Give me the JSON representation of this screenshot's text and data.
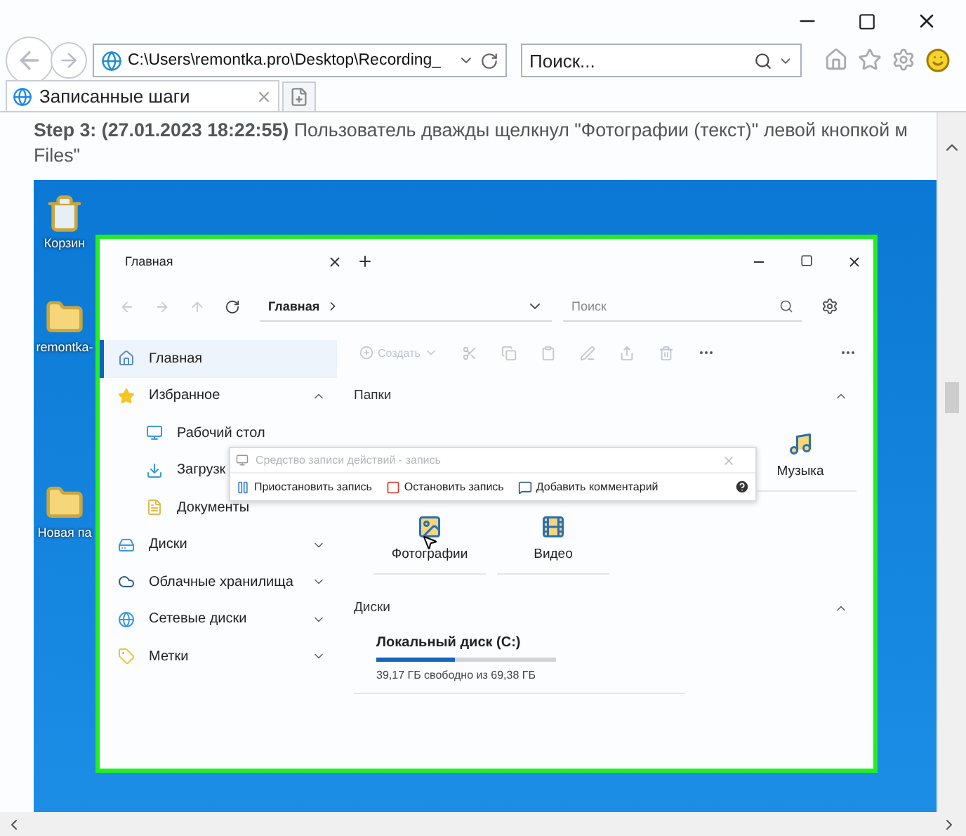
{
  "browser": {
    "address": "C:\\Users\\remontka.pro\\Desktop\\Recording_",
    "search_placeholder": "Поиск...",
    "tabs": [
      {
        "label": "Записанные шаги",
        "selected": true
      }
    ]
  },
  "step": {
    "lines": [
      "**Step 3: (27.01.2023 18:22:55)** Пользователь дважды щелкнул \"Фотографии (текст)\" левой кнопкой м",
      "Files\""
    ]
  },
  "desktop": {
    "icons": [
      {
        "label": "Корзин",
        "kind": "recycle"
      },
      {
        "label": "remontka-",
        "kind": "folder"
      },
      {
        "label": "Новая па",
        "kind": "folder"
      }
    ]
  },
  "explorer": {
    "tab": "Главная",
    "breadcrumb": "Главная",
    "search_placeholder": "Поиск",
    "sidebar": [
      {
        "label": "Главная",
        "kind": "home",
        "selected": true
      },
      {
        "label": "Избранное",
        "kind": "star",
        "selected": false,
        "expanded": true,
        "children": [
          {
            "label": "Рабочий стол",
            "kind": "desktop",
            "selected": false
          },
          {
            "label": "Загрузк",
            "kind": "download",
            "selected": false
          },
          {
            "label": "Документы",
            "kind": "document",
            "selected": false
          }
        ]
      },
      {
        "label": "Диски",
        "kind": "drive",
        "selected": false,
        "expanded": false
      },
      {
        "label": "Облачные хранилища",
        "kind": "cloud",
        "selected": false,
        "expanded": false
      },
      {
        "label": "Сетевые диски",
        "kind": "network",
        "selected": false,
        "expanded": false
      },
      {
        "label": "Метки",
        "kind": "tag",
        "selected": false,
        "expanded": false
      }
    ],
    "toolbar": {
      "new_label": "Создать"
    },
    "folders_section": {
      "title": "Папки",
      "expanded": true,
      "folders": [
        {
          "label": "Музыка",
          "kind": "music"
        },
        {
          "label": "Фотографии",
          "kind": "photo"
        },
        {
          "label": "Видео",
          "kind": "video"
        }
      ]
    },
    "drives_section": {
      "title": "Диски",
      "expanded": true,
      "drives": [
        {
          "name": "Локальный диск (C:)",
          "level": 0.44,
          "free": "39,17 ГБ свободно из 69,38 ГБ"
        }
      ]
    }
  },
  "recorder": {
    "title": "Средство записи действий - запись",
    "buttons": [
      {
        "label": "Приостановить запись",
        "kind": "pause"
      },
      {
        "label": "Остановить запись",
        "kind": "stop"
      },
      {
        "label": "Добавить комментарий",
        "kind": "comment"
      }
    ]
  }
}
